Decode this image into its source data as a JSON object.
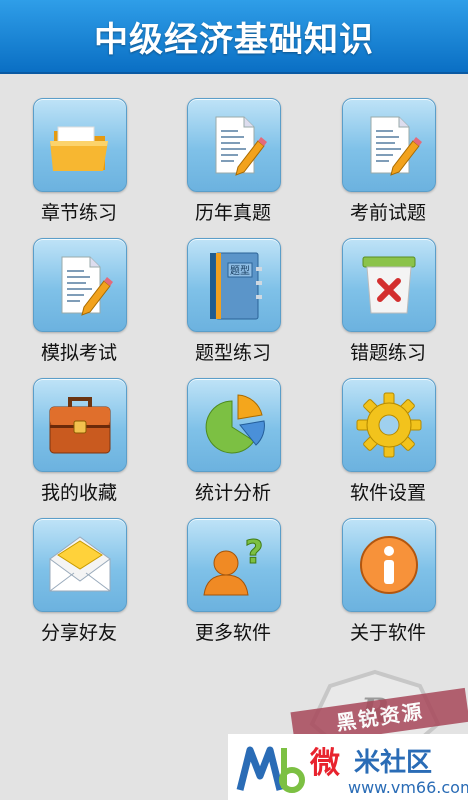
{
  "header": {
    "title": "中级经济基础知识"
  },
  "tiles": [
    {
      "label": "章节练习",
      "icon": "folder-icon"
    },
    {
      "label": "历年真题",
      "icon": "document-pencil-icon"
    },
    {
      "label": "考前试题",
      "icon": "document-pencil-icon"
    },
    {
      "label": "模拟考试",
      "icon": "document-pencil-icon"
    },
    {
      "label": "题型练习",
      "icon": "notebook-icon",
      "icon_text": "题型"
    },
    {
      "label": "错题练习",
      "icon": "trash-icon"
    },
    {
      "label": "我的收藏",
      "icon": "briefcase-icon"
    },
    {
      "label": "统计分析",
      "icon": "pie-chart-icon"
    },
    {
      "label": "软件设置",
      "icon": "gear-icon"
    },
    {
      "label": "分享好友",
      "icon": "envelope-icon"
    },
    {
      "label": "更多软件",
      "icon": "person-question-icon"
    },
    {
      "label": "关于软件",
      "icon": "info-icon"
    }
  ],
  "watermark": {
    "banner": "黑锐资源",
    "brand_a": "微",
    "brand_b": "米社区",
    "url": "www.vm66.com"
  }
}
